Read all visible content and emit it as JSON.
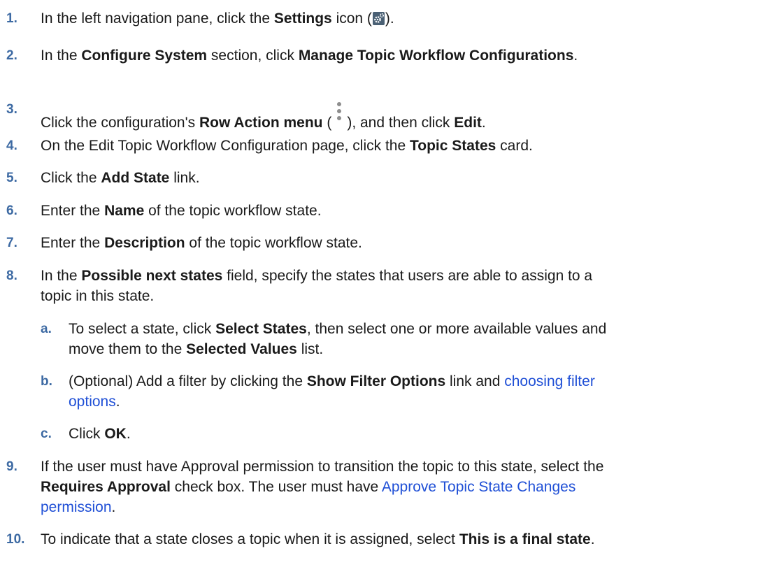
{
  "steps": [
    {
      "num": "1.",
      "t1": "In the left navigation pane, click the ",
      "b1": "Settings",
      "t2": " icon (",
      "t3": ")."
    },
    {
      "num": "2.",
      "t1": "In the ",
      "b1": "Configure System",
      "t2": " section, click ",
      "b2": "Manage Topic Workflow Configurations",
      "t3": "."
    },
    {
      "num": "3.",
      "t1": "Click the configuration's ",
      "b1": "Row Action menu",
      "t2": " (",
      "t3": "), and then click ",
      "b2": "Edit",
      "t4": "."
    },
    {
      "num": "4.",
      "t1": "On the Edit Topic Workflow Configuration page, click the ",
      "b1": "Topic States",
      "t2": " card."
    },
    {
      "num": "5.",
      "t1": "Click the ",
      "b1": "Add State",
      "t2": " link."
    },
    {
      "num": "6.",
      "t1": "Enter the ",
      "b1": "Name",
      "t2": " of the topic workflow state."
    },
    {
      "num": "7.",
      "t1": "Enter the ",
      "b1": "Description",
      "t2": " of the topic workflow state."
    },
    {
      "num": "8.",
      "t1": "In the ",
      "b1": "Possible next states",
      "t2": " field, specify the states that users are able to assign to a",
      "line2": "topic in this state."
    },
    {
      "num": "9.",
      "t1": "If the user must have Approval permission to transition the topic to this state, select the",
      "b1": "Requires Approval",
      "t2": " check box. The user must have ",
      "link1": "Approve Topic State Changes",
      "link2": "permission",
      "t3": "."
    },
    {
      "num": "10.",
      "t1": "To indicate that a state closes a topic when it is assigned, select ",
      "b1": "This is a final state",
      "t2": "."
    }
  ],
  "substeps": [
    {
      "num": "a.",
      "t1": "To select a state, click ",
      "b1": "Select States",
      "t2": ", then select one or more available values and",
      "t3": "move them to the ",
      "b2": "Selected Values",
      "t4": " list."
    },
    {
      "num": "b.",
      "t1": "(Optional) Add a filter by clicking the ",
      "b1": "Show Filter Options",
      "t2": " link and ",
      "link1": "choosing filter",
      "link2": "options",
      "t3": "."
    },
    {
      "num": "c.",
      "t1": "Click ",
      "b1": "OK",
      "t2": "."
    }
  ],
  "icons": {
    "settings": "settings-gear-icon",
    "row_action": "kebab-menu-icon"
  }
}
